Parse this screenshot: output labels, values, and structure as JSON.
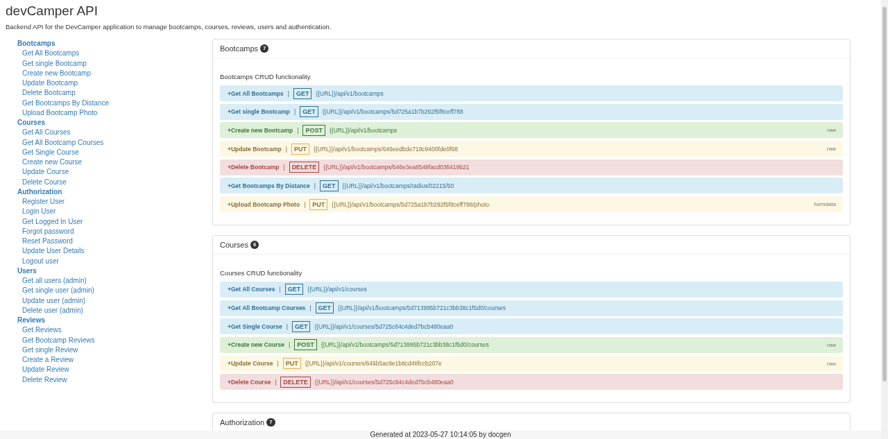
{
  "page": {
    "title": "devCamper API",
    "description": "Backend API for the DevCamper application to manage bootcamps, courses, reviews, users and authentication."
  },
  "sidebar": [
    {
      "heading": "Bootcamps",
      "items": [
        "Get All Bootcamps",
        "Get single Bootcamp",
        "Create new Bootcamp",
        "Update Bootcamp",
        "Delete Bootcamp",
        "Get Bootcamps By Distance",
        "Upload Bootcamp Photo"
      ]
    },
    {
      "heading": "Courses",
      "items": [
        "Get All Courses",
        "Get All Bootcamp Courses",
        "Get Single Course",
        "Create new Course",
        "Update Course",
        "Delete Course"
      ]
    },
    {
      "heading": "Authorization",
      "items": [
        "Register User",
        "Login User",
        "Get Logged In User",
        "Forgot password",
        "Reset Password",
        "Update User Details",
        "Logout user"
      ]
    },
    {
      "heading": "Users",
      "items": [
        "Get all users (admin)",
        "Get single user (admin)",
        "Update user (admin)",
        "Delete user (admin)"
      ]
    },
    {
      "heading": "Reviews",
      "items": [
        "Get Reviews",
        "Get Bootcamp Reviews",
        "Get single Review",
        "Create a Review",
        "Update Review",
        "Delete Review"
      ]
    }
  ],
  "sections": [
    {
      "title": "Bootcamps",
      "count": "7",
      "description": "Bootcamps CRUD functionality",
      "endpoints": [
        {
          "name": "+Get All Bootcamps",
          "sep": "|",
          "kind": "get",
          "method": "GET",
          "url": "{{URL}}/api/v1/bootcamps"
        },
        {
          "name": "+Get single Bootcamp",
          "sep": "|",
          "kind": "get",
          "method": "GET",
          "url": "{{URL}}/api/v1/bootcamps/5d725a1b7b292f5f8ceff788"
        },
        {
          "name": "+Create new Bootcamp",
          "sep": "|",
          "kind": "post",
          "method": "POST",
          "url": "{{URL}}/api/v1/bootcamps",
          "body": "raw"
        },
        {
          "name": "+Update Bootcamp",
          "sep": "|",
          "kind": "put",
          "method": "PUT",
          "url": "{{URL}}/api/v1/bootcamps/646eedbde718c9400fde0f68",
          "body": "raw"
        },
        {
          "name": "+Delete Bootcamp",
          "sep": "|",
          "kind": "delete",
          "method": "DELETE",
          "url": "{{URL}}/api/v1/bootcamps/646e3ea8549facd036419b21"
        },
        {
          "name": "+Get Bootcamps By Distance",
          "sep": "|",
          "kind": "get",
          "method": "GET",
          "url": "{{URL}}/api/v1/bootcamps/radius/02215/50"
        },
        {
          "name": "+Upload Bootcamp Photo",
          "sep": "|",
          "kind": "put",
          "method": "PUT",
          "url": "{{URL}}/api/v1/bootcamps/5d725a1b7b292f5f8ceff788/photo",
          "body": "formdata"
        }
      ]
    },
    {
      "title": "Courses",
      "count": "6",
      "description": "Courses CRUD functionality",
      "endpoints": [
        {
          "name": "+Get All Courses",
          "sep": "|",
          "kind": "get",
          "method": "GET",
          "url": "{{URL}}/api/v1/courses"
        },
        {
          "name": "+Get All Bootcamp Courses",
          "sep": "|",
          "kind": "get",
          "method": "GET",
          "url": "{{URL}}/api/v1/bootcamps/5d713995b721c3bb38c1f5d0/courses"
        },
        {
          "name": "+Get Single Course",
          "sep": "|",
          "kind": "get",
          "method": "GET",
          "url": "{{URL}}/api/v1/courses/5d725c84c4ded7bcb480eaa0"
        },
        {
          "name": "+Create new Course",
          "sep": "|",
          "kind": "post",
          "method": "POST",
          "url": "{{URL}}/api/v1/bootcamps/5d713995b721c3bb38c1f5d0/courses",
          "body": "raw"
        },
        {
          "name": "+Update Course",
          "sep": "|",
          "kind": "put",
          "method": "PUT",
          "url": "{{URL}}/api/v1/courses/646b5ac8e1b8cd48fccb207e",
          "body": "raw"
        },
        {
          "name": "+Delete Course",
          "sep": "|",
          "kind": "delete",
          "method": "DELETE",
          "url": "{{URL}}/api/v1/courses/5d725c84c4ded7bcb480eaa0"
        }
      ]
    },
    {
      "title": "Authorization",
      "count": "7"
    }
  ],
  "footer": "Generated at 2023-05-27 10:14:05 by docgen"
}
